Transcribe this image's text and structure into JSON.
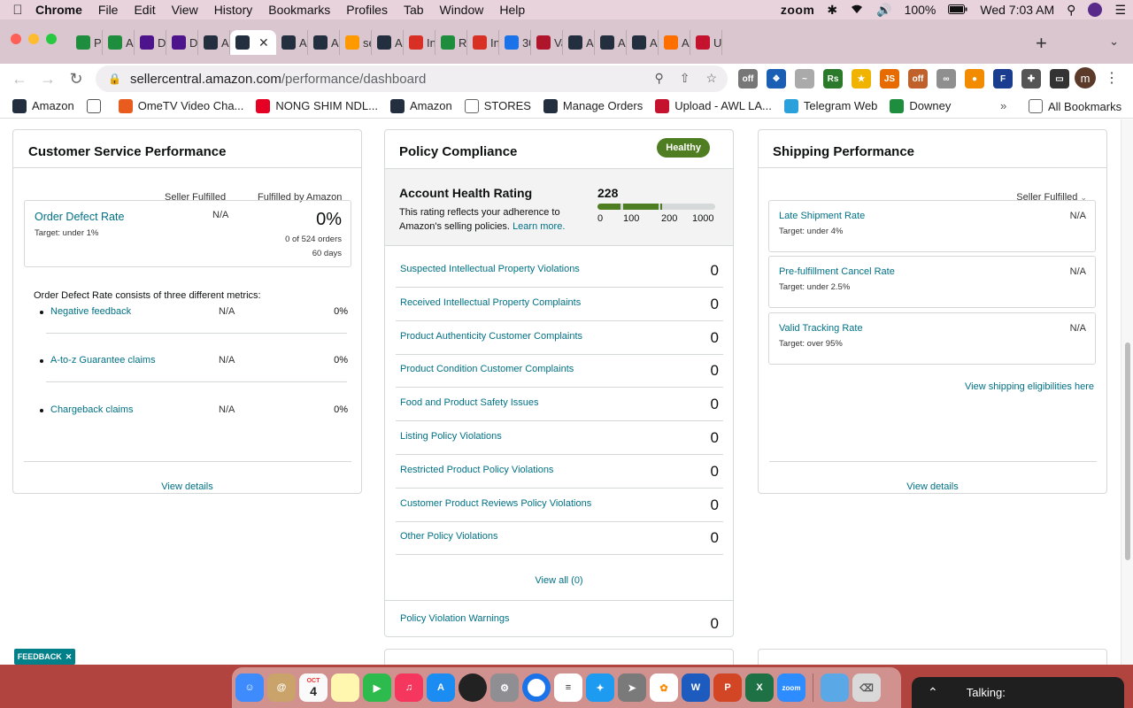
{
  "menubar": {
    "app": "Chrome",
    "items": [
      "File",
      "Edit",
      "View",
      "History",
      "Bookmarks",
      "Profiles",
      "Tab",
      "Window",
      "Help"
    ],
    "zoom_label": "zoom",
    "battery": "100%",
    "clock": "Wed 7:03 AM"
  },
  "tabs": [
    {
      "label": "PR",
      "icon": "sheets-icon",
      "color": "#1e8e3e"
    },
    {
      "label": "Au",
      "icon": "sheets-icon",
      "color": "#1e8e3e"
    },
    {
      "label": "De",
      "icon": "fedex-icon",
      "color": "#4d148c"
    },
    {
      "label": "De",
      "icon": "fedex-icon",
      "color": "#4d148c"
    },
    {
      "label": "An",
      "icon": "amazon-icon",
      "color": "#232f3e"
    },
    {
      "label": "",
      "icon": "amazon-icon",
      "color": "#232f3e",
      "active": true
    },
    {
      "label": "An",
      "icon": "amazon-icon",
      "color": "#232f3e"
    },
    {
      "label": "An",
      "icon": "amazon-icon",
      "color": "#232f3e"
    },
    {
      "label": "se",
      "icon": "amazon-smile-icon",
      "color": "#ff9900"
    },
    {
      "label": "An",
      "icon": "amazon-icon",
      "color": "#232f3e"
    },
    {
      "label": "Inb",
      "icon": "gmail-icon",
      "color": "#d93025"
    },
    {
      "label": "Re",
      "icon": "sheets-icon",
      "color": "#1e8e3e"
    },
    {
      "label": "Inb",
      "icon": "gmail-icon",
      "color": "#d93025"
    },
    {
      "label": "30",
      "icon": "calendar-icon",
      "color": "#1a73e8"
    },
    {
      "label": "Va",
      "icon": "vw-icon",
      "color": "#b0162b"
    },
    {
      "label": "An",
      "icon": "amazon-icon",
      "color": "#232f3e"
    },
    {
      "label": "An",
      "icon": "amazon-icon",
      "color": "#232f3e"
    },
    {
      "label": "An",
      "icon": "amazon-icon",
      "color": "#232f3e"
    },
    {
      "label": "AN",
      "icon": "pen-icon",
      "color": "#ff6f00"
    },
    {
      "label": "Up",
      "icon": "upload-icon",
      "color": "#c4122f"
    }
  ],
  "address": {
    "domain": "sellercentral.amazon.com",
    "path": "/performance/dashboard"
  },
  "profile_initial": "m",
  "bookmarks": [
    {
      "label": "Amazon",
      "icon": "amazon-icon",
      "color": "#232f3e"
    },
    {
      "label": "",
      "icon": "globe-icon",
      "color": "#555555"
    },
    {
      "label": "OmeTV Video Cha...",
      "icon": "ometv-icon",
      "color": "#e85d1f"
    },
    {
      "label": "NONG SHIM NDL...",
      "icon": "pinterest-icon",
      "color": "#e60023"
    },
    {
      "label": "Amazon",
      "icon": "amazon-icon",
      "color": "#232f3e"
    },
    {
      "label": "STORES",
      "icon": "folder-icon",
      "color": "#666666"
    },
    {
      "label": "Manage Orders",
      "icon": "amazon-icon",
      "color": "#232f3e"
    },
    {
      "label": "Upload - AWL LA...",
      "icon": "upload-icon",
      "color": "#c4122f"
    },
    {
      "label": "Telegram Web",
      "icon": "telegram-icon",
      "color": "#2aa1da"
    },
    {
      "label": "Downey",
      "icon": "sheets-icon",
      "color": "#1e8e3e"
    }
  ],
  "all_bookmarks": "All Bookmarks",
  "customer_service": {
    "title": "Customer Service Performance",
    "col_seller": "Seller Fulfilled",
    "col_amazon": "Fulfilled by Amazon",
    "odr_name": "Order Defect Rate",
    "odr_target": "Target: under 1%",
    "odr_seller": "N/A",
    "odr_pct": "0%",
    "odr_orders": "0 of 524 orders",
    "odr_days": "60 days",
    "consists": "Order Defect Rate consists of three different metrics:",
    "metrics": [
      {
        "name": "Negative feedback",
        "seller": "N/A",
        "amazon": "0%"
      },
      {
        "name": "A-to-z Guarantee claims",
        "seller": "N/A",
        "amazon": "0%"
      },
      {
        "name": "Chargeback claims",
        "seller": "N/A",
        "amazon": "0%"
      }
    ],
    "view_details": "View details"
  },
  "policy": {
    "title": "Policy Compliance",
    "badge": "Healthy",
    "ahr_title": "Account Health Rating",
    "ahr_desc": "This rating reflects your adherence to Amazon's selling policies.",
    "learn_more": "Learn more.",
    "score": "228",
    "ticks": [
      "0",
      "100",
      "200",
      "1000"
    ],
    "violations": [
      {
        "name": "Suspected Intellectual Property Violations",
        "count": "0"
      },
      {
        "name": "Received Intellectual Property Complaints",
        "count": "0"
      },
      {
        "name": "Product Authenticity Customer Complaints",
        "count": "0"
      },
      {
        "name": "Product Condition Customer Complaints",
        "count": "0"
      },
      {
        "name": "Food and Product Safety Issues",
        "count": "0"
      },
      {
        "name": "Listing Policy Violations",
        "count": "0"
      },
      {
        "name": "Restricted Product Policy Violations",
        "count": "0"
      },
      {
        "name": "Customer Product Reviews Policy Violations",
        "count": "0"
      },
      {
        "name": "Other Policy Violations",
        "count": "0"
      }
    ],
    "view_all": "View all (0)",
    "warnings_name": "Policy Violation Warnings",
    "warnings_count": "0"
  },
  "shipping": {
    "title": "Shipping Performance",
    "select": "Seller Fulfilled",
    "rows": [
      {
        "name": "Late Shipment Rate",
        "target": "Target: under 4%",
        "value": "N/A"
      },
      {
        "name": "Pre-fulfillment Cancel Rate",
        "target": "Target: under 2.5%",
        "value": "N/A"
      },
      {
        "name": "Valid Tracking Rate",
        "target": "Target: over 95%",
        "value": "N/A"
      }
    ],
    "eligibility_link": "View shipping eligibilities here",
    "view_details": "View details"
  },
  "feedback": "FEEDBACK",
  "dock_date": "4",
  "dock_month": "OCT",
  "talking": "Talking:"
}
